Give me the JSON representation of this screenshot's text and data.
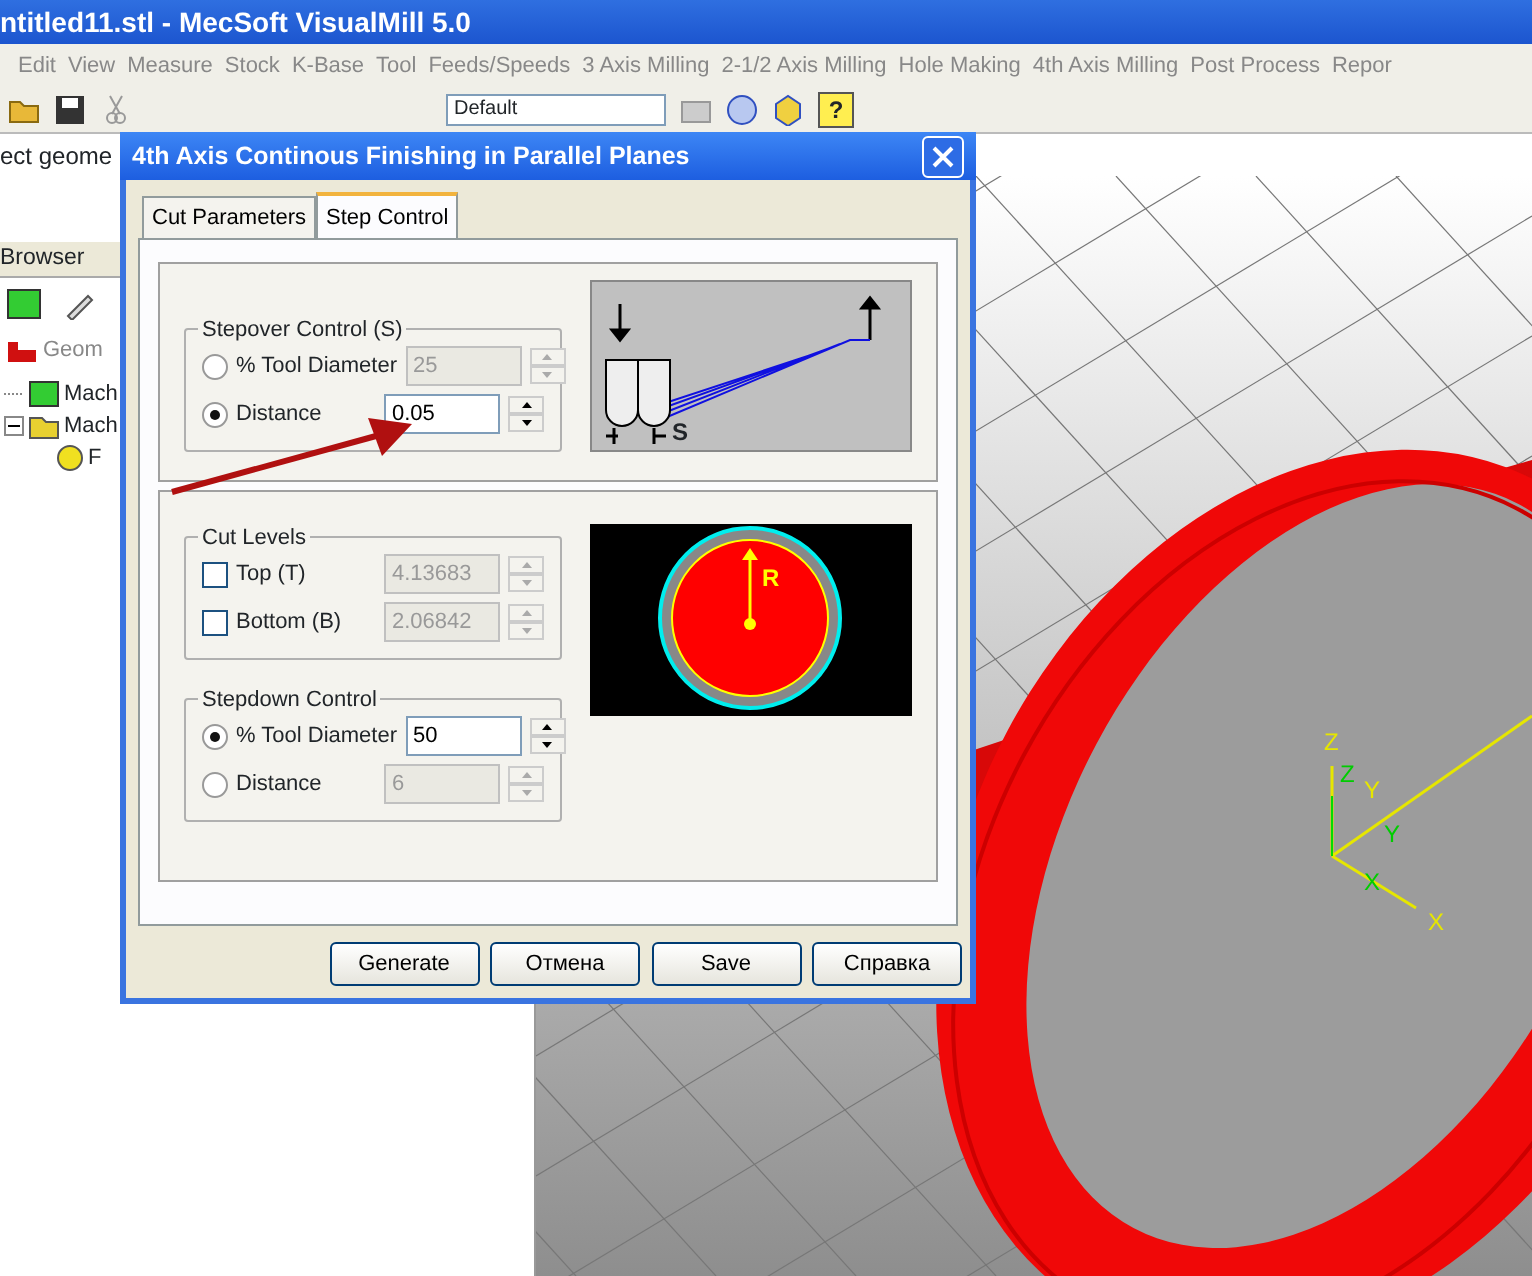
{
  "app": {
    "title": "ntitled11.stl - MecSoft VisualMill 5.0"
  },
  "menu": [
    "Edit",
    "View",
    "Measure",
    "Stock",
    "K-Base",
    "Tool",
    "Feeds/Speeds",
    "3 Axis Milling",
    "2-1/2 Axis Milling",
    "Hole Making",
    "4th Axis Milling",
    "Post Process",
    "Repor"
  ],
  "toolbar": {
    "layer_combo": "Default",
    "help_label": "?"
  },
  "prompt": "ect geome",
  "browser": {
    "title": "Browser",
    "tab": "Geom",
    "tree": [
      {
        "label": "Mach",
        "expanded": false
      },
      {
        "label": "Mach",
        "expanded": true,
        "children": [
          {
            "label": "F"
          }
        ]
      }
    ]
  },
  "viewport": {
    "axis_labels": [
      {
        "text": "Z",
        "color": "#e6e600"
      },
      {
        "text": "Y",
        "color": "#e6e600"
      },
      {
        "text": "X",
        "color": "#e6e600"
      },
      {
        "text": "Z",
        "color": "#00cc00"
      },
      {
        "text": "Y",
        "color": "#00cc00"
      },
      {
        "text": "X",
        "color": "#00cc00"
      }
    ]
  },
  "dialog": {
    "title": "4th Axis Continous Finishing in Parallel Planes",
    "tabs": [
      {
        "label": "Cut Parameters",
        "selected": false
      },
      {
        "label": "Step Control",
        "selected": true
      }
    ],
    "stepover": {
      "title": "Stepover Control (S)",
      "options": [
        {
          "label": "% Tool Diameter",
          "value": "25",
          "selected": false
        },
        {
          "label": "Distance",
          "value": "0.05",
          "selected": true
        }
      ],
      "diagram_label": "S"
    },
    "cut_levels": {
      "title": "Cut Levels",
      "options": [
        {
          "label": "Top (T)",
          "value": "4.13683",
          "checked": false
        },
        {
          "label": "Bottom (B)",
          "value": "2.06842",
          "checked": false
        }
      ],
      "diagram_label": "R"
    },
    "stepdown": {
      "title": "Stepdown Control",
      "options": [
        {
          "label": "% Tool Diameter",
          "value": "50",
          "selected": true
        },
        {
          "label": "Distance",
          "value": "6",
          "selected": false
        }
      ]
    },
    "buttons": [
      "Generate",
      "Отмена",
      "Save",
      "Справка"
    ]
  }
}
